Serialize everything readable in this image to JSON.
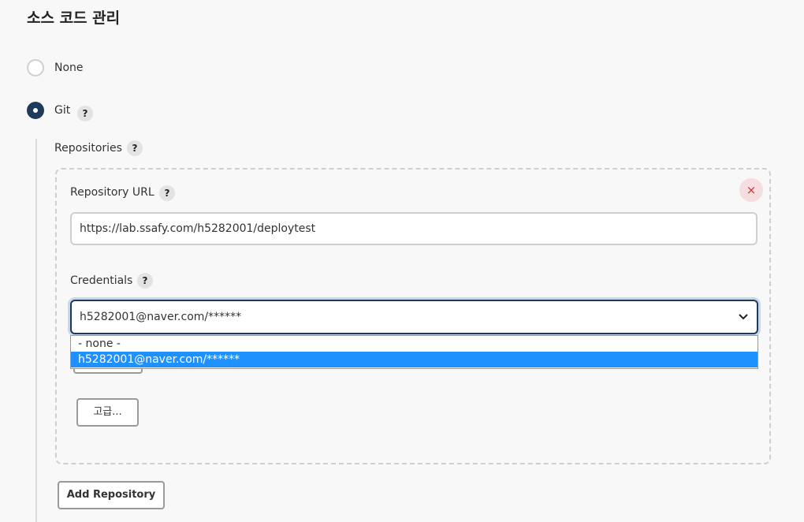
{
  "section": {
    "title": "소스 코드 관리"
  },
  "scm": {
    "none_label": "None",
    "git_label": "Git",
    "help_glyph": "?",
    "selected": "Git"
  },
  "repositories": {
    "label": "Repositories",
    "repo_url_label": "Repository URL",
    "repo_url_value": "https://lab.ssafy.com/h5282001/deploytest",
    "credentials_label": "Credentials",
    "credentials_selected": "h5282001@naver.com/******",
    "credentials_options": [
      "- none -",
      "h5282001@naver.com/******"
    ],
    "close_glyph": "×",
    "advanced_button": "고급...",
    "add_repository_button": "Add Repository"
  },
  "icons": {
    "radio_off": "radio-unchecked-icon",
    "radio_on": "radio-checked-icon",
    "help": "help-icon",
    "close": "close-icon",
    "chevron": "chevron-down-icon"
  },
  "colors": {
    "accent": "#1f3b5a",
    "highlight": "#1e90ff",
    "close_bg": "#f6dde0",
    "close_fg": "#c0392b"
  }
}
